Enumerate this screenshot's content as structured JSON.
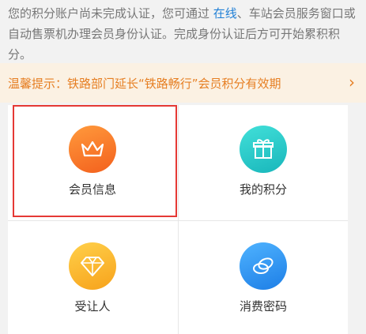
{
  "notice": {
    "text_before": "您的积分账户尚未完成认证，您可通过 ",
    "link": "在线",
    "text_after": "、车站会员服务窗口或自动售票机办理会员身份认证。完成身份认证后方可开始累积积分。"
  },
  "tip": {
    "text": "温馨提示：铁路部门延长“铁路畅行”会员积分有效期"
  },
  "grid": {
    "items": [
      {
        "label": "会员信息",
        "icon": "crown-icon"
      },
      {
        "label": "我的积分",
        "icon": "gift-icon"
      },
      {
        "label": "受让人",
        "icon": "diamond-icon"
      },
      {
        "label": "消费密码",
        "icon": "coins-icon"
      }
    ]
  },
  "colors": {
    "accent": "#e67e22",
    "link": "#1f7fd6",
    "highlight": "#e53935"
  }
}
